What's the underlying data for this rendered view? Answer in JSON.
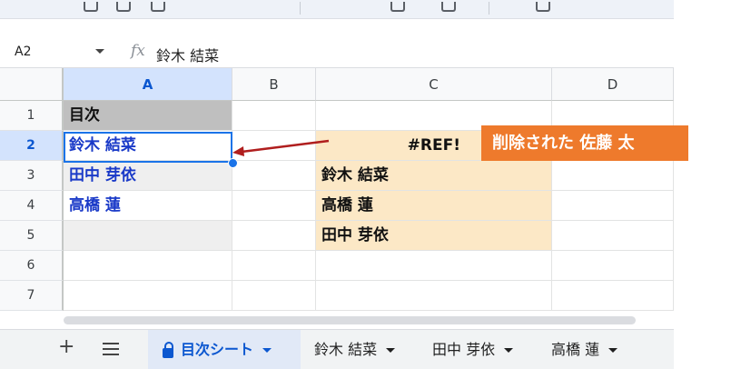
{
  "formula_bar": {
    "namebox": "A2",
    "fx_label": "fx",
    "value": "鈴木 結菜"
  },
  "columns": [
    "A",
    "B",
    "C",
    "D"
  ],
  "rows": [
    "1",
    "2",
    "3",
    "4",
    "5",
    "6",
    "7"
  ],
  "cells": {
    "A1": "目次",
    "A2": "鈴木 結菜",
    "A3": "田中 芽依",
    "A4": "高橋 蓮",
    "C2": "#REF!",
    "C3": "鈴木 結菜",
    "C4": "高橋 蓮",
    "C5": "田中 芽依"
  },
  "callout": {
    "text": "削除された 佐藤 太"
  },
  "tabs": {
    "add_label": "+",
    "items": [
      {
        "label": "目次シート",
        "active": true
      },
      {
        "label": "鈴木 結菜"
      },
      {
        "label": "田中 芽依"
      },
      {
        "label": "高橋 蓮"
      }
    ]
  },
  "colors": {
    "accent_blue": "#1a73e8",
    "link_blue": "#1a3ac8",
    "callout_orange": "#ee7a2c",
    "peach": "#fce8c6",
    "arrow_red": "#b01e1e"
  },
  "icons": [
    "chevron-down-icon",
    "fx-icon",
    "add-sheet-icon",
    "all-sheets-menu-icon",
    "lock-icon",
    "arrow-icon"
  ]
}
